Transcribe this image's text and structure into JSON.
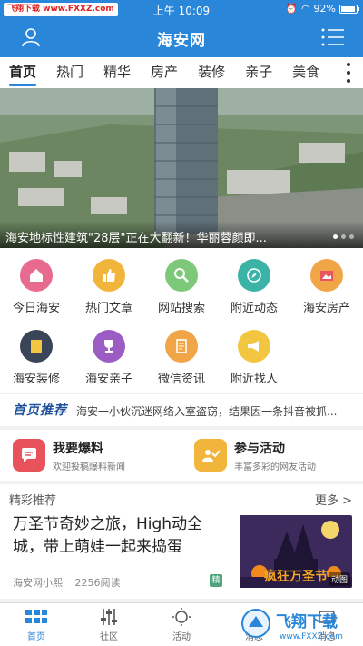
{
  "status_bar": {
    "source_badge": "飞翔下载 www.FXXZ.com",
    "time": "上午 10:09",
    "battery": "92%"
  },
  "app": {
    "title": "海安网",
    "accent_color": "#2a86d8"
  },
  "tabs": [
    {
      "label": "首页",
      "active": true
    },
    {
      "label": "热门"
    },
    {
      "label": "精华"
    },
    {
      "label": "房产"
    },
    {
      "label": "装修"
    },
    {
      "label": "亲子"
    },
    {
      "label": "美食"
    }
  ],
  "banner": {
    "caption": "海安地标性建筑\"28层\"正在大翻新！华丽蓉颜即..."
  },
  "grid": [
    {
      "label": "今日海安",
      "icon": "home-icon",
      "color": "#e86a8e"
    },
    {
      "label": "热门文章",
      "icon": "thumbs-up-icon",
      "color": "#f0b53a"
    },
    {
      "label": "网站搜索",
      "icon": "search-icon",
      "color": "#7ec87a"
    },
    {
      "label": "附近动态",
      "icon": "compass-icon",
      "color": "#3bb3a7"
    },
    {
      "label": "海安房产",
      "icon": "house-image-icon",
      "color": "#f0a646"
    },
    {
      "label": "海安装修",
      "icon": "note-icon",
      "color": "#3a4658"
    },
    {
      "label": "海安亲子",
      "icon": "trophy-icon",
      "color": "#9b5cc4"
    },
    {
      "label": "微信资讯",
      "icon": "document-icon",
      "color": "#f0a646"
    },
    {
      "label": "附近找人",
      "icon": "megaphone-icon",
      "color": "#f3c642"
    }
  ],
  "ticker": {
    "badge": "首页推荐",
    "text": "海安一小伙沉迷网络入室盗窃，结果因一条抖音被抓..."
  },
  "features": [
    {
      "title": "我要爆料",
      "subtitle": "欢迎投稿爆料新闻",
      "icon": "chat-bubble-icon",
      "color": "#e8525b"
    },
    {
      "title": "参与活动",
      "subtitle": "丰富多彩的网友活动",
      "icon": "activity-icon",
      "color": "#f0b53a"
    }
  ],
  "section": {
    "title": "精彩推荐",
    "more": "更多 >"
  },
  "article": {
    "title": "万圣节奇妙之旅，High动全城，带上萌娃一起来捣蛋",
    "author": "海安网小熙",
    "reads": "2256阅读",
    "tag": "精",
    "thumb_text": "疯狂万圣节",
    "thumb_label": "动图"
  },
  "bottom_nav": [
    {
      "label": "首页",
      "icon": "grid-icon",
      "active": true
    },
    {
      "label": "社区",
      "icon": "sliders-icon"
    },
    {
      "label": "活动",
      "icon": "sun-icon"
    },
    {
      "label": "消息",
      "icon": "bell-icon"
    },
    {
      "label": "消息",
      "icon": "message-icon"
    }
  ],
  "watermark": {
    "text": "飞翔下载",
    "url": "www.FXXZ.com"
  }
}
